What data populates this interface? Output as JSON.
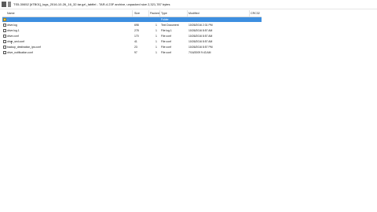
{
  "window": {
    "title": "TS5-30652 [#TB01]_logs_2016-10-26_16_32.tar.gz\\_tabfiel - TAR-4.23F archive, unpacked size 2,321,787 bytes"
  },
  "columns": {
    "name": "Name",
    "size": "Size",
    "packed": "Packed",
    "type": "Type",
    "modified": "Modified",
    "crc": "CRC32"
  },
  "rows": [
    {
      "name": "..",
      "size": "",
      "packed": "",
      "type": "Folder",
      "modified": "",
      "selected": true,
      "icon": "folder-icon"
    },
    {
      "name": "drive.log",
      "size": "698",
      "packed": "1",
      "type": "Text Document",
      "modified": "10/26/2016 2:31 PM",
      "selected": false,
      "icon": "file-icon"
    },
    {
      "name": "drive.log.1",
      "size": "278",
      "packed": "1",
      "type": "File log.1",
      "modified": "10/26/2016 8:57 AM",
      "selected": false,
      "icon": "file-icon"
    },
    {
      "name": "drive.conf",
      "size": "170",
      "packed": "1",
      "type": "File conf",
      "modified": "10/26/2016 8:57 AM",
      "selected": false,
      "icon": "file-icon"
    },
    {
      "name": "drive_sed.conf",
      "size": "41",
      "packed": "1",
      "type": "File conf",
      "modified": "10/26/2016 8:57 AM",
      "selected": false,
      "icon": "file-icon"
    },
    {
      "name": "backup_destination_ips.conf",
      "size": "23",
      "packed": "1",
      "type": "File conf",
      "modified": "10/26/2016 8:57 PM",
      "selected": false,
      "icon": "file-icon"
    },
    {
      "name": "drive_notification.conf",
      "size": "97",
      "packed": "1",
      "type": "File conf",
      "modified": "7/16/2009 9:43 AM",
      "selected": false,
      "icon": "file-icon"
    }
  ]
}
